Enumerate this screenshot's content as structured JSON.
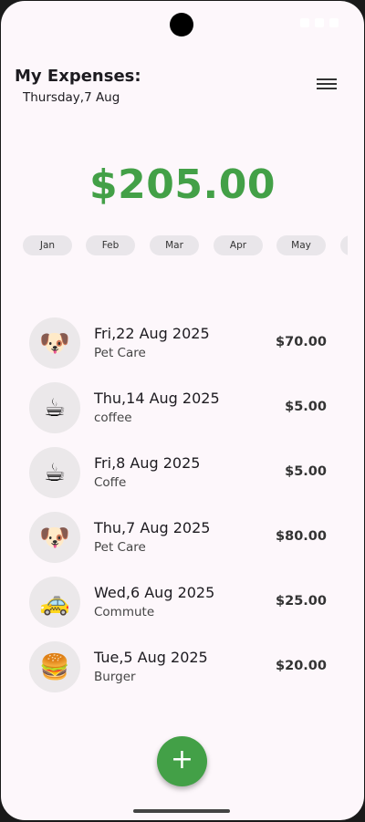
{
  "header": {
    "title": "My Expenses:",
    "date": "Thursday,7 Aug"
  },
  "icons": {
    "menu": "hamburger-menu-icon",
    "add": "plus-icon"
  },
  "colors": {
    "accent": "#43a047",
    "background": "#fdf7fb",
    "chip": "#e9e6ea"
  },
  "total": "$205.00",
  "months": [
    "Jan",
    "Feb",
    "Mar",
    "Apr",
    "May",
    ""
  ],
  "expenses": [
    {
      "icon": "🐶",
      "date": "Fri,22 Aug 2025",
      "category": "Pet Care",
      "amount": "$70.00"
    },
    {
      "icon": "☕",
      "date": "Thu,14 Aug 2025",
      "category": "coffee",
      "amount": "$5.00"
    },
    {
      "icon": "☕",
      "date": "Fri,8 Aug 2025",
      "category": "Coffe",
      "amount": "$5.00"
    },
    {
      "icon": "🐶",
      "date": "Thu,7 Aug 2025",
      "category": "Pet Care",
      "amount": "$80.00"
    },
    {
      "icon": "🚕",
      "date": "Wed,6 Aug 2025",
      "category": "Commute",
      "amount": "$25.00"
    },
    {
      "icon": "🍔",
      "date": "Tue,5 Aug 2025",
      "category": "Burger",
      "amount": "$20.00"
    }
  ],
  "fab": {
    "label": "+"
  }
}
